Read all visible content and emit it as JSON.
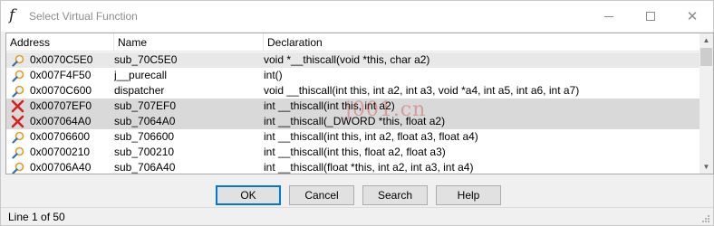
{
  "window": {
    "title": "Select Virtual Function",
    "title_icon": "function-f-icon"
  },
  "columns": {
    "address": "Address",
    "name": "Name",
    "declaration": "Declaration"
  },
  "rows": [
    {
      "icon": "magnifier-icon",
      "address": "0x0070C5E0",
      "name": "sub_70C5E0",
      "declaration": "void *__thiscall(void *this, char a2)",
      "state": "focus"
    },
    {
      "icon": "magnifier-icon",
      "address": "0x007F4F50",
      "name": "j__purecall",
      "declaration": "int()",
      "state": ""
    },
    {
      "icon": "magnifier-icon",
      "address": "0x0070C600",
      "name": "dispatcher",
      "declaration": "void __thiscall(int this, int a2, int a3, void *a4, int a5, int a6, int a7)",
      "state": ""
    },
    {
      "icon": "red-x-icon",
      "address": "0x00707EF0",
      "name": "sub_707EF0",
      "declaration": "int __thiscall(int this, int a2)",
      "state": "sel"
    },
    {
      "icon": "red-x-icon",
      "address": "0x007064A0",
      "name": "sub_7064A0",
      "declaration": "int __thiscall(_DWORD *this, float a2)",
      "state": "sel"
    },
    {
      "icon": "magnifier-icon",
      "address": "0x00706600",
      "name": "sub_706600",
      "declaration": "int __thiscall(int this, int a2, float a3, float a4)",
      "state": ""
    },
    {
      "icon": "magnifier-icon",
      "address": "0x00700210",
      "name": "sub_700210",
      "declaration": "int __thiscall(int this, float a2, float a3)",
      "state": ""
    },
    {
      "icon": "magnifier-icon",
      "address": "0x00706A40",
      "name": "sub_706A40",
      "declaration": "int __thiscall(float *this, int a2, int a3, int a4)",
      "state": ""
    }
  ],
  "buttons": {
    "ok": "OK",
    "cancel": "Cancel",
    "search": "Search",
    "help": "Help"
  },
  "status": {
    "text": "Line 1 of 50"
  },
  "watermark": {
    "text": "j001.cn"
  },
  "colors": {
    "selected_row": "#d9d9d9",
    "default_button_border": "#0078d7",
    "error_icon": "#d42020",
    "magnifier_icon": "#e0a020"
  }
}
